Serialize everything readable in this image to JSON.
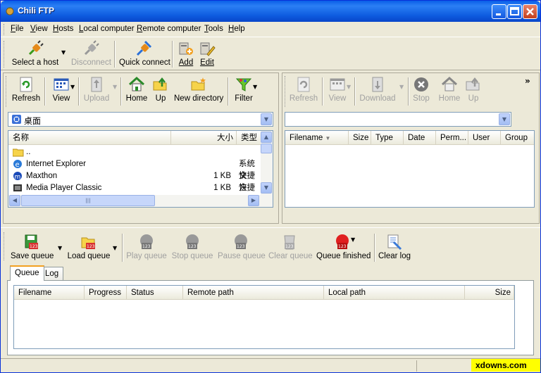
{
  "window": {
    "title": "Chili FTP"
  },
  "menubar": {
    "items": [
      {
        "pre": "",
        "u": "F",
        "post": "ile"
      },
      {
        "pre": "",
        "u": "V",
        "post": "iew"
      },
      {
        "pre": "",
        "u": "H",
        "post": "osts"
      },
      {
        "pre": "",
        "u": "L",
        "post": "ocal computer"
      },
      {
        "pre": "",
        "u": "R",
        "post": "emote computer"
      },
      {
        "pre": "",
        "u": "T",
        "post": "ools"
      },
      {
        "pre": "",
        "u": "H",
        "post": "elp"
      }
    ]
  },
  "main_toolbar": {
    "select_host": "Select a host",
    "disconnect": "Disconnect",
    "quick_connect": "Quick connect",
    "add": "Add",
    "edit": "Edit"
  },
  "local_toolbar": {
    "refresh": "Refresh",
    "view": "View",
    "upload": "Upload",
    "home": "Home",
    "up": "Up",
    "new_directory": "New directory",
    "filter": "Filter"
  },
  "remote_toolbar": {
    "refresh": "Refresh",
    "view": "View",
    "download": "Download",
    "stop": "Stop",
    "home": "Home",
    "up": "Up",
    "more": "»"
  },
  "local_path": {
    "value": "桌面"
  },
  "remote_path": {
    "value": ""
  },
  "local_list": {
    "columns": [
      "名称",
      "大小",
      "类型"
    ],
    "rows": [
      {
        "name": "..",
        "size": "",
        "type": ""
      },
      {
        "name": "Internet Explorer",
        "size": "",
        "type": "系统文"
      },
      {
        "name": "Maxthon",
        "size": "1 KB",
        "type": "快捷方"
      },
      {
        "name": "Media Player Classic",
        "size": "1 KB",
        "type": "快捷方"
      }
    ]
  },
  "remote_list": {
    "columns": [
      "Filename",
      "Size",
      "Type",
      "Date",
      "Perm...",
      "User",
      "Group"
    ]
  },
  "queue_toolbar": {
    "save_queue": "Save queue",
    "load_queue": "Load queue",
    "play_queue": "Play queue",
    "stop_queue": "Stop queue",
    "pause_queue": "Pause queue",
    "clear_queue": "Clear queue",
    "queue_finished": "Queue finished",
    "clear_log": "Clear log"
  },
  "tabs": {
    "queue": "Queue",
    "log": "Log"
  },
  "queue_list": {
    "columns": [
      "Filename",
      "Progress",
      "Status",
      "Remote path",
      "Local path",
      "Size"
    ]
  },
  "watermark": "xdowns.com",
  "colors": {
    "titlebar": "#0a5ee8",
    "face": "#ece9d8",
    "accent": "#316ac5"
  }
}
